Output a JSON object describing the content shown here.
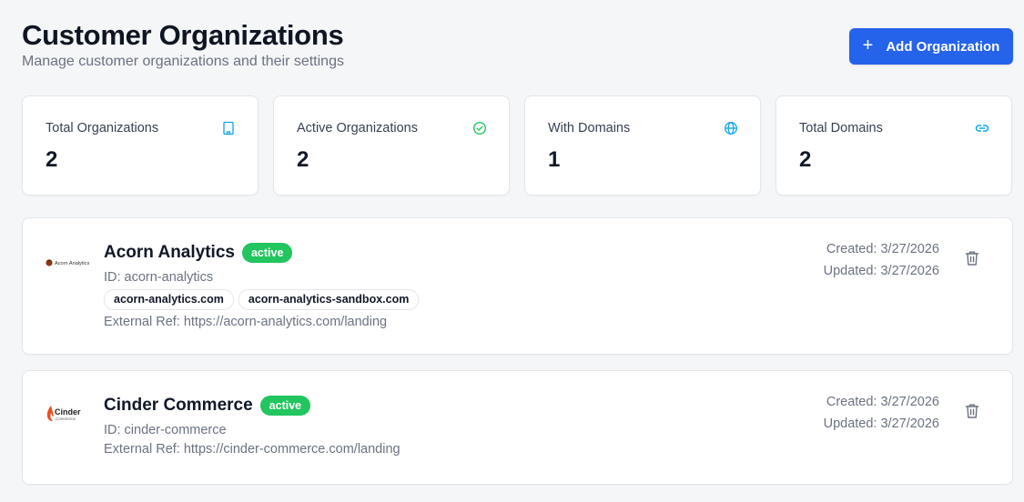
{
  "header": {
    "title": "Customer Organizations",
    "subtitle": "Manage customer organizations and their settings",
    "add_button_label": "Add Organization"
  },
  "stats": [
    {
      "label": "Total Organizations",
      "value": "2",
      "icon": "building-icon",
      "color": "#0ea5e9"
    },
    {
      "label": "Active Organizations",
      "value": "2",
      "icon": "check-circle-icon",
      "color": "#22c55e"
    },
    {
      "label": "With Domains",
      "value": "1",
      "icon": "globe-icon",
      "color": "#0ea5e9"
    },
    {
      "label": "Total Domains",
      "value": "2",
      "icon": "link-icon",
      "color": "#0ea5e9"
    }
  ],
  "organizations": [
    {
      "name": "Acorn Analytics",
      "status": "active",
      "id_text": "ID: acorn-analytics",
      "domains": [
        "acorn-analytics.com",
        "acorn-analytics-sandbox.com"
      ],
      "external_ref": "External Ref: https://acorn-analytics.com/landing",
      "created": "Created: 3/27/2026",
      "updated": "Updated: 3/27/2026",
      "logo_text": "Acorn Analytics"
    },
    {
      "name": "Cinder Commerce",
      "status": "active",
      "id_text": "ID: cinder-commerce",
      "domains": [],
      "external_ref": "External Ref: https://cinder-commerce.com/landing",
      "created": "Created: 3/27/2026",
      "updated": "Updated: 3/27/2026",
      "logo_text": "Cinder",
      "logo_subtext": "Commerce"
    }
  ],
  "colors": {
    "primary": "#2563eb",
    "active": "#22c55e",
    "muted_text": "#6b7280",
    "border": "#e3e6ea",
    "background": "#f5f6f8"
  }
}
